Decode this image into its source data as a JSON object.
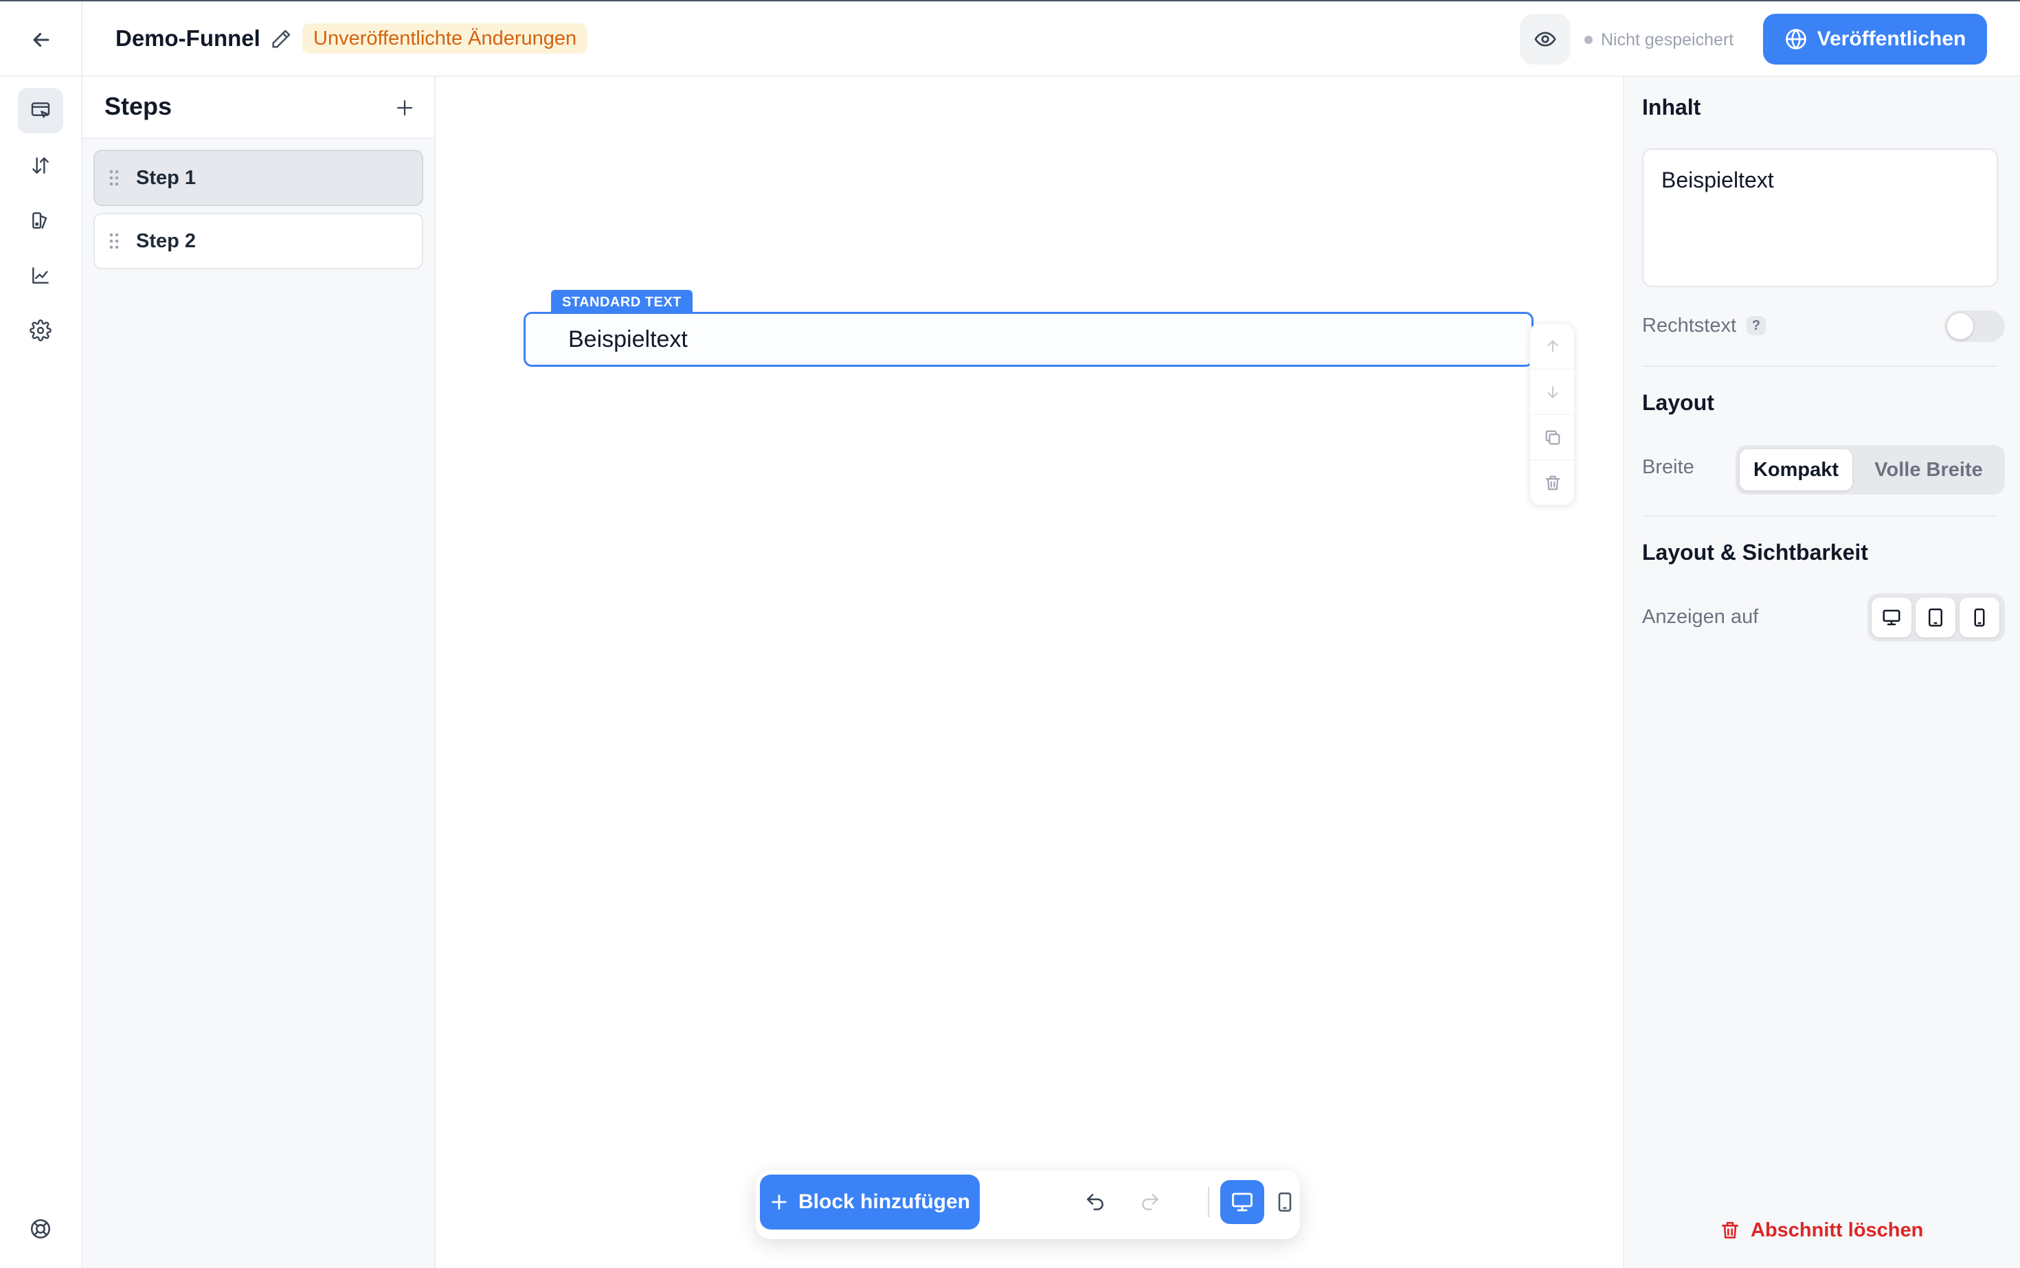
{
  "header": {
    "funnel_title": "Demo-Funnel",
    "unsaved_badge": "Unveröffentlichte Änderungen",
    "save_status": "Nicht gespeichert",
    "publish_label": "Veröffentlichen"
  },
  "rail": {
    "items": [
      {
        "icon": "editor-icon",
        "active": true
      },
      {
        "icon": "sort-arrows-icon",
        "active": false
      },
      {
        "icon": "design-icon",
        "active": false
      },
      {
        "icon": "analytics-icon",
        "active": false
      },
      {
        "icon": "gear-icon",
        "active": false
      }
    ],
    "bottom_icon": "help-lifebuoy-icon"
  },
  "steps": {
    "title": "Steps",
    "items": [
      {
        "label": "Step 1",
        "active": true
      },
      {
        "label": "Step 2",
        "active": false
      }
    ]
  },
  "canvas": {
    "block_tag": "STANDARD TEXT",
    "block_text": "Beispieltext",
    "add_block_label": "Block hinzufügen"
  },
  "properties": {
    "content_title": "Inhalt",
    "content_value": "Beispieltext",
    "legal_text_label": "Rechtstext",
    "legal_text_help": "?",
    "legal_text_enabled": false,
    "layout_title": "Layout",
    "width_label": "Breite",
    "width_options": [
      "Kompakt",
      "Volle Breite"
    ],
    "width_selected": "Kompakt",
    "visibility_title": "Layout & Sichtbarkeit",
    "show_on_label": "Anzeigen auf",
    "show_on_devices": [
      "desktop-icon",
      "tablet-icon",
      "mobile-icon"
    ],
    "delete_section_label": "Abschnitt löschen"
  },
  "colors": {
    "accent": "#3b82f6",
    "badge_bg": "#fdf3d9",
    "badge_text": "#d2630f",
    "danger": "#dc2626"
  }
}
